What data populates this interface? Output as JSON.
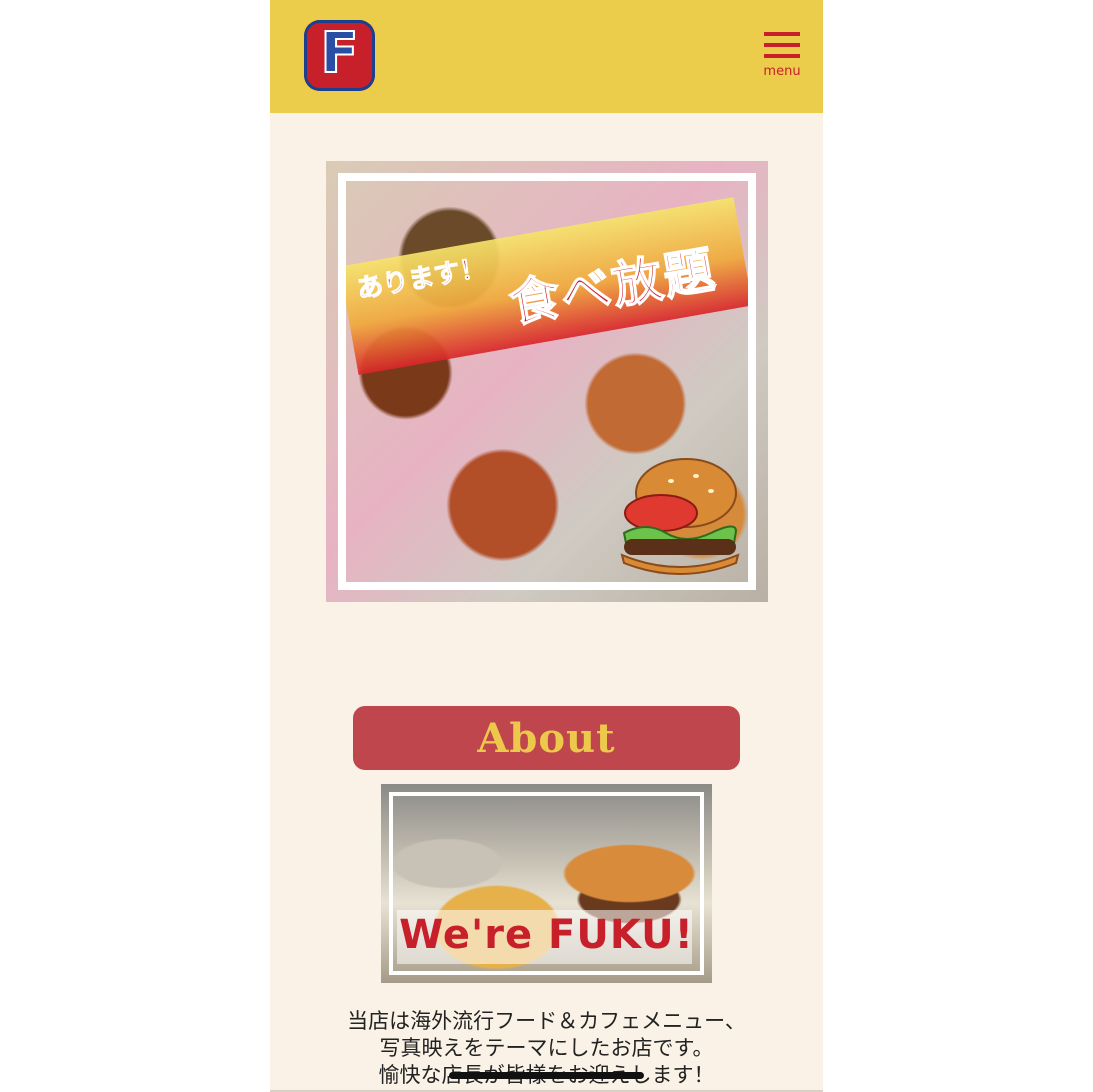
{
  "header": {
    "logo_letter": "F",
    "menu_label": "menu"
  },
  "hero": {
    "banner_small": "あります！",
    "banner_big": "食べ放題"
  },
  "about": {
    "heading": "About",
    "photo_caption": "We're FUKU!",
    "body_lines": [
      "当店は海外流行フード＆カフェメニュー、",
      "写真映えをテーマにしたお店です。",
      "愉快な店長が皆様をお迎えします！"
    ]
  },
  "colors": {
    "header_bg": "#eccc4b",
    "page_bg": "#faf2e6",
    "brand_red": "#c8202a",
    "about_pill": "#c0464d",
    "about_text": "#ecc94b"
  },
  "icons": [
    "logo-f-icon",
    "hamburger-menu-icon",
    "burger-illustration-icon"
  ]
}
